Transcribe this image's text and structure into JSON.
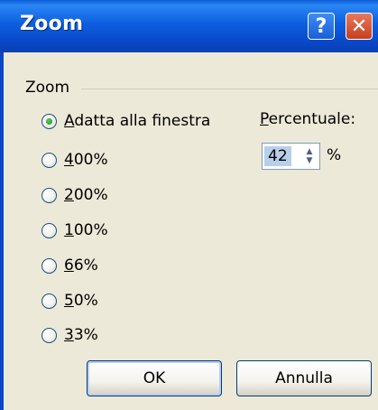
{
  "window": {
    "title": "Zoom",
    "help_glyph": "?",
    "close_glyph": "✕"
  },
  "group": {
    "label": "Zoom"
  },
  "options": [
    {
      "key": "A",
      "rest": "datta alla finestra",
      "selected": true
    },
    {
      "key": "4",
      "rest": "00%",
      "selected": false
    },
    {
      "key": "2",
      "rest": "00%",
      "selected": false
    },
    {
      "key": "1",
      "rest": "00%",
      "selected": false
    },
    {
      "key": "6",
      "rest": "6%",
      "selected": false
    },
    {
      "key": "5",
      "rest": "0%",
      "selected": false
    },
    {
      "key": "3",
      "rest": "3%",
      "selected": false
    }
  ],
  "percent": {
    "label_key": "P",
    "label_rest": "ercentuale:",
    "value": "42",
    "unit": "%"
  },
  "buttons": {
    "ok": "OK",
    "cancel": "Annulla"
  }
}
